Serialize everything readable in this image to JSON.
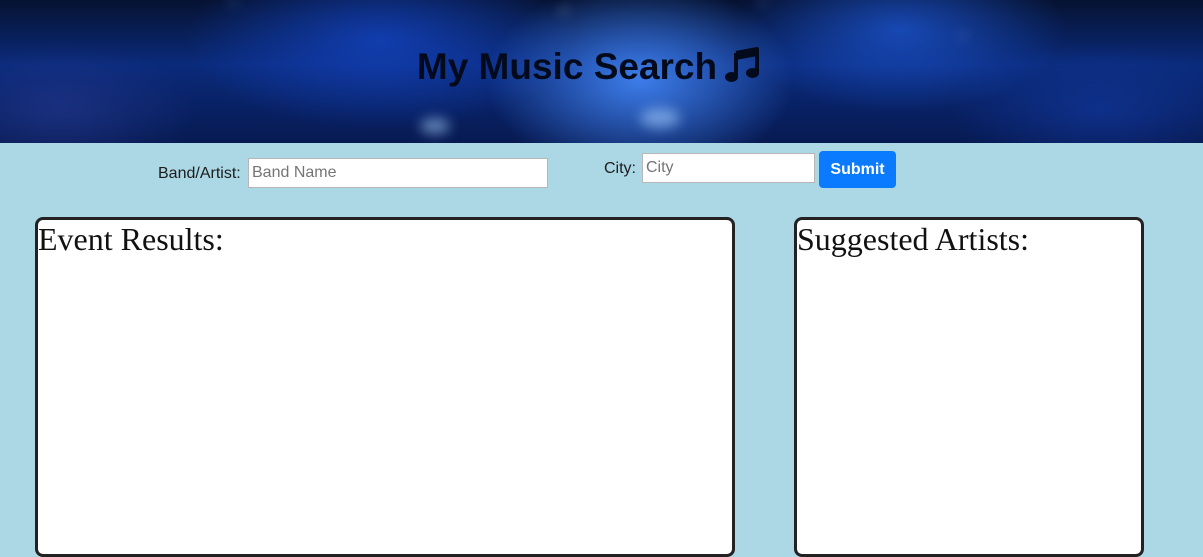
{
  "header": {
    "title": "My Music Search",
    "icon": "music-note-icon"
  },
  "search": {
    "artist_label": "Band/Artist:",
    "artist_placeholder": "Band Name",
    "artist_value": "",
    "city_label": "City:",
    "city_placeholder": "City",
    "city_value": "",
    "submit_label": "Submit"
  },
  "panels": {
    "events_title": "Event Results:",
    "suggested_title": "Suggested Artists:"
  },
  "colors": {
    "page_background": "#acd8e5",
    "submit_button": "#0a7bff",
    "panel_border": "#222222"
  }
}
